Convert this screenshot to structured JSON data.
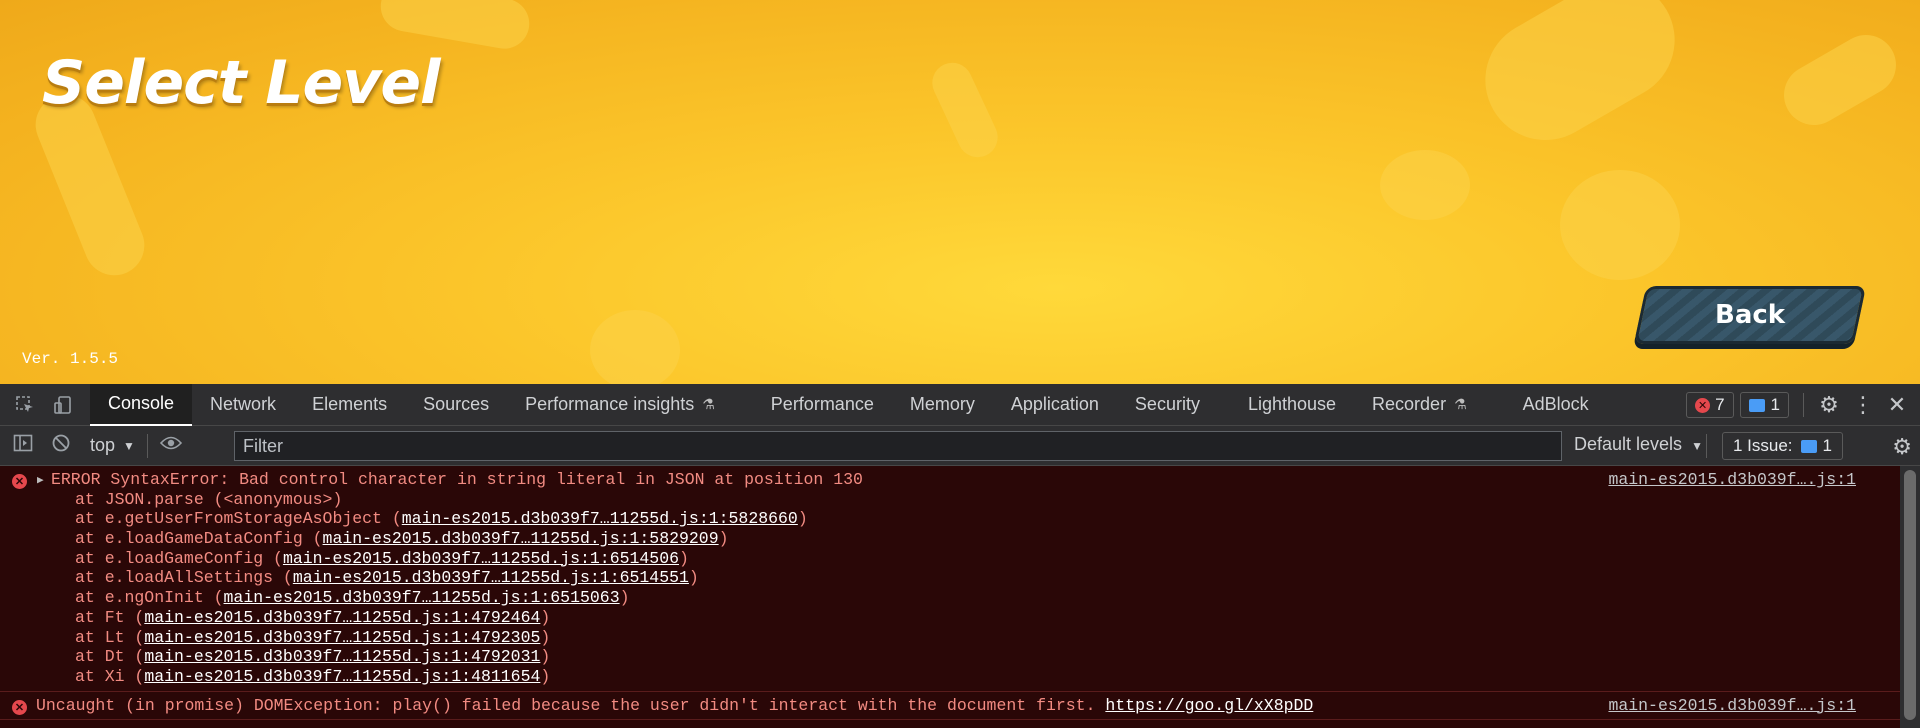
{
  "game": {
    "title": "Select Level",
    "version": "Ver. 1.5.5",
    "back_label": "Back"
  },
  "devtools": {
    "tabs": [
      "Console",
      "Network",
      "Elements",
      "Sources",
      "Performance insights",
      "Performance",
      "Memory",
      "Application",
      "Security",
      "Lighthouse",
      "Recorder",
      "AdBlock"
    ],
    "error_count": "7",
    "message_count": "1",
    "context": "top",
    "filter_placeholder": "Filter",
    "levels_label": "Default levels",
    "issues_label": "1 Issue:",
    "issues_count": "1",
    "console": {
      "error1": {
        "message": "ERROR SyntaxError: Bad control character in string literal in JSON at position 130",
        "source": "main-es2015.d3b039f….js:1",
        "stack": [
          {
            "prefix": "at JSON.parse (<anonymous>)",
            "link": "",
            "suffix": ""
          },
          {
            "prefix": "at e.getUserFromStorageAsObject (",
            "link": "main-es2015.d3b039f7…11255d.js:1:5828660",
            "suffix": ")"
          },
          {
            "prefix": "at e.loadGameDataConfig (",
            "link": "main-es2015.d3b039f7…11255d.js:1:5829209",
            "suffix": ")"
          },
          {
            "prefix": "at e.loadGameConfig (",
            "link": "main-es2015.d3b039f7…11255d.js:1:6514506",
            "suffix": ")"
          },
          {
            "prefix": "at e.loadAllSettings (",
            "link": "main-es2015.d3b039f7…11255d.js:1:6514551",
            "suffix": ")"
          },
          {
            "prefix": "at e.ngOnInit (",
            "link": "main-es2015.d3b039f7…11255d.js:1:6515063",
            "suffix": ")"
          },
          {
            "prefix": "at Ft (",
            "link": "main-es2015.d3b039f7…11255d.js:1:4792464",
            "suffix": ")"
          },
          {
            "prefix": "at Lt (",
            "link": "main-es2015.d3b039f7…11255d.js:1:4792305",
            "suffix": ")"
          },
          {
            "prefix": "at Dt (",
            "link": "main-es2015.d3b039f7…11255d.js:1:4792031",
            "suffix": ")"
          },
          {
            "prefix": "at Xi (",
            "link": "main-es2015.d3b039f7…11255d.js:1:4811654",
            "suffix": ")"
          }
        ]
      },
      "error2": {
        "message": "Uncaught (in promise) DOMException: play() failed because the user didn't interact with the document first. ",
        "link": "https://goo.gl/xX8pDD",
        "source": "main-es2015.d3b039f….js:1"
      }
    }
  }
}
